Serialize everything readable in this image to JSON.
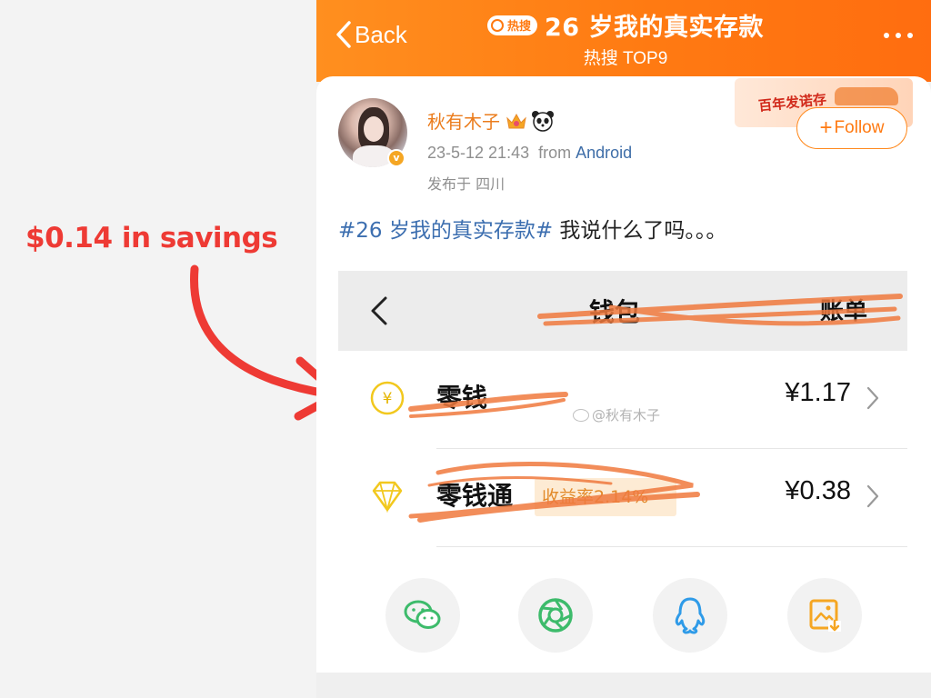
{
  "annotation": {
    "text": "$0.14 in savings",
    "color": "#ee3a34"
  },
  "topbar": {
    "back_label": "Back",
    "hot_badge": "热搜",
    "title": "26 岁我的真实存款",
    "subtitle": "热搜 TOP9",
    "accent": "#ff7a12"
  },
  "post": {
    "username": "秋有木子",
    "timestamp": "23-5-12 21:43",
    "from_word": "from",
    "source": "Android",
    "location": "发布于 四川",
    "follow_label": "Follow",
    "promo_text": "百年发诺存",
    "hashtag": "#26 岁我的真实存款#",
    "text": " 我说什么了吗。。。"
  },
  "wallet": {
    "title": "钱包",
    "bill_label": "账单",
    "rows": [
      {
        "label": "零钱",
        "value": "¥1.17",
        "icon": "yuan-coin-icon"
      },
      {
        "label": "零钱通",
        "value": "¥0.38",
        "icon": "diamond-icon",
        "rate_tag": "收益率2.14%"
      }
    ],
    "watermark": "@秋有木子"
  },
  "share": [
    {
      "name": "wechat-share-button",
      "icon": "wechat-icon",
      "color": "#3dbb6b"
    },
    {
      "name": "moments-share-button",
      "icon": "moments-aperture-icon",
      "color": "#3dbb6b"
    },
    {
      "name": "qq-share-button",
      "icon": "qq-penguin-icon",
      "color": "#2f9be8"
    },
    {
      "name": "save-image-button",
      "icon": "save-image-icon",
      "color": "#f5a623"
    }
  ]
}
